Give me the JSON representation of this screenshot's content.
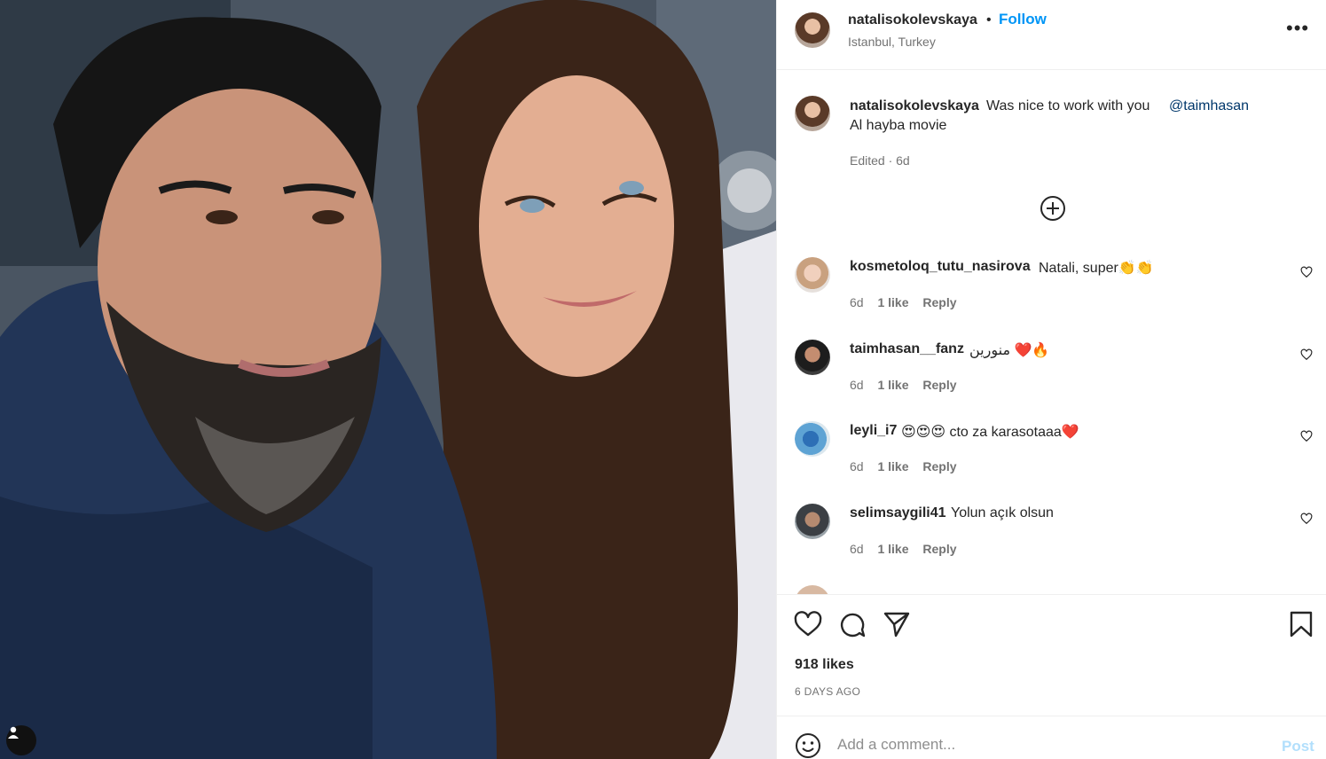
{
  "post": {
    "photo_alt": "post-photo",
    "tag_icon": "user-tag-icon"
  },
  "header": {
    "username": "natalisokolevskaya",
    "separator": "•",
    "follow_label": "Follow",
    "location": "Istanbul, Turkey",
    "more_icon": "more-options-icon",
    "more_glyph": "•••"
  },
  "caption": {
    "username": "natalisokolevskaya",
    "text": "Was nice to work with you",
    "mention": "@taimhasan",
    "line2": "Al hayba movie",
    "edited": "Edited · 6d"
  },
  "comments": [
    {
      "username": "kosmetoloq_tutu_nasirova",
      "text": "Natali, super👏👏",
      "time": "6d",
      "likes": "1 like",
      "reply": "Reply"
    },
    {
      "username": "taimhasan__fanz",
      "text": "منورين ❤️🔥",
      "time": "6d",
      "likes": "1 like",
      "reply": "Reply"
    },
    {
      "username": "leyli_i7",
      "text": "😍😍😍 cto za karasotaaa❤️",
      "time": "6d",
      "likes": "1 like",
      "reply": "Reply"
    },
    {
      "username": "selimsaygili41",
      "text": "Yolun açık olsun",
      "time": "6d",
      "likes": "1 like",
      "reply": "Reply"
    }
  ],
  "footer": {
    "likes": "918 likes",
    "posted": "6 DAYS AGO",
    "comment_placeholder": "Add a comment...",
    "post_label": "Post"
  },
  "colors": {
    "accent": "#0095f6",
    "mention": "#00376b",
    "muted": "#737373",
    "post_disabled": "#b2dffc"
  }
}
